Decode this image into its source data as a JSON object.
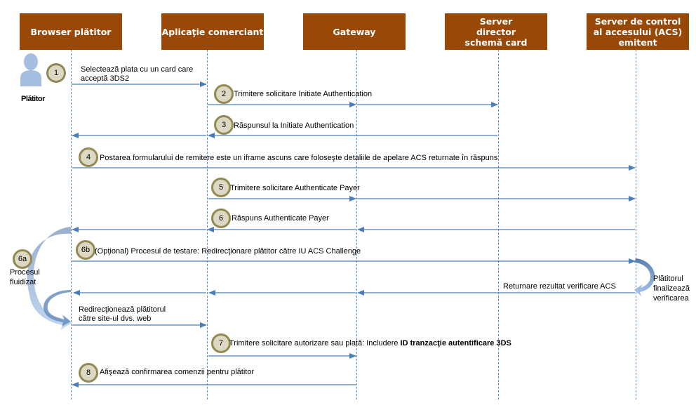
{
  "actors": [
    {
      "id": "browser",
      "label": "Browser plătitor"
    },
    {
      "id": "merchant",
      "label": "Aplicaţie comerciant"
    },
    {
      "id": "gateway",
      "label": "Gateway"
    },
    {
      "id": "ds",
      "label": "Server director schemă card"
    },
    {
      "id": "acs",
      "label": "Server de control al accesului (ACS) emitent"
    }
  ],
  "payer_label": "Plătitor",
  "colors": {
    "actor_bg": "#984807",
    "arrow": "#4a7ebb",
    "badge_fill": "#ddd8c3",
    "badge_ring": "#938953"
  },
  "steps": {
    "s1": {
      "badge": "1",
      "text_line1": "Selectează plata cu un card care",
      "text_line2": "acceptă 3DS2"
    },
    "s2": {
      "badge": "2",
      "text": "Trimitere solicitare Initiate Authentication"
    },
    "s3": {
      "badge": "3",
      "text": "Răspunsul la Initiate Authentication"
    },
    "s4": {
      "badge": "4",
      "text": "Postarea formularului de remitere este un iframe ascuns care foloseşte detaliile de apelare ACS returnate în răspuns"
    },
    "s5": {
      "badge": "5",
      "text": "Trimitere solicitare Authenticate Payer"
    },
    "s6": {
      "badge": "6",
      "text": "Răspuns Authenticate Payer"
    },
    "s6a": {
      "badge": "6a",
      "text_line1": "Procesul",
      "text_line2": "fluidizat"
    },
    "s6b": {
      "badge": "6b",
      "text": "(Opţional) Procesul de testare: Redirecţionare plătitor către IU ACS Challenge"
    },
    "acs_note": {
      "line1": "Plătitorul",
      "line2": "finalizează",
      "line3": "verificarea"
    },
    "acs_result": {
      "text": "Returnare rezultat verificare ACS"
    },
    "redirect": {
      "line1": "Redirecţionează plătitorul",
      "line2": "către site-ul dvs. web"
    },
    "s7": {
      "badge": "7",
      "text_plain": "Trimitere solicitare autorizare sau plată: Includere ",
      "text_bold": "ID tranzacţie autentificare 3DS"
    },
    "s8": {
      "badge": "8",
      "text": "Afişează confirmarea comenzii pentru plătitor"
    }
  }
}
